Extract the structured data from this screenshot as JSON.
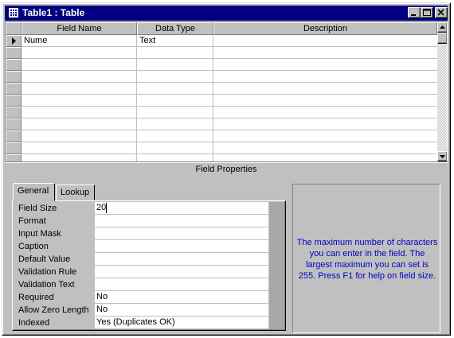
{
  "window": {
    "title": "Table1 : Table",
    "icons": {
      "app": "table-icon",
      "minimize": "minimize-icon",
      "maximize": "maximize-icon",
      "close": "close-icon"
    }
  },
  "grid": {
    "columns": [
      "Field Name",
      "Data Type",
      "Description"
    ],
    "rows": [
      {
        "field_name": "Nume",
        "data_type": "Text",
        "description": ""
      }
    ],
    "current_row_indicator": "triangle-right-icon"
  },
  "field_properties": {
    "section_label": "Field Properties",
    "tabs": [
      "General",
      "Lookup"
    ],
    "active_tab": "General",
    "properties": [
      {
        "label": "Field Size",
        "value": "20"
      },
      {
        "label": "Format",
        "value": ""
      },
      {
        "label": "Input Mask",
        "value": ""
      },
      {
        "label": "Caption",
        "value": ""
      },
      {
        "label": "Default Value",
        "value": ""
      },
      {
        "label": "Validation Rule",
        "value": ""
      },
      {
        "label": "Validation Text",
        "value": ""
      },
      {
        "label": "Required",
        "value": "No"
      },
      {
        "label": "Allow Zero Length",
        "value": "No"
      },
      {
        "label": "Indexed",
        "value": "Yes (Duplicates OK)"
      }
    ],
    "help_text": "The maximum number of characters you can enter in the field.  The largest maximum you can set is 255.  Press F1 for help on field size."
  },
  "colors": {
    "title_bar": "#000080",
    "help_text": "#0000c0",
    "face": "#c0c0c0"
  }
}
